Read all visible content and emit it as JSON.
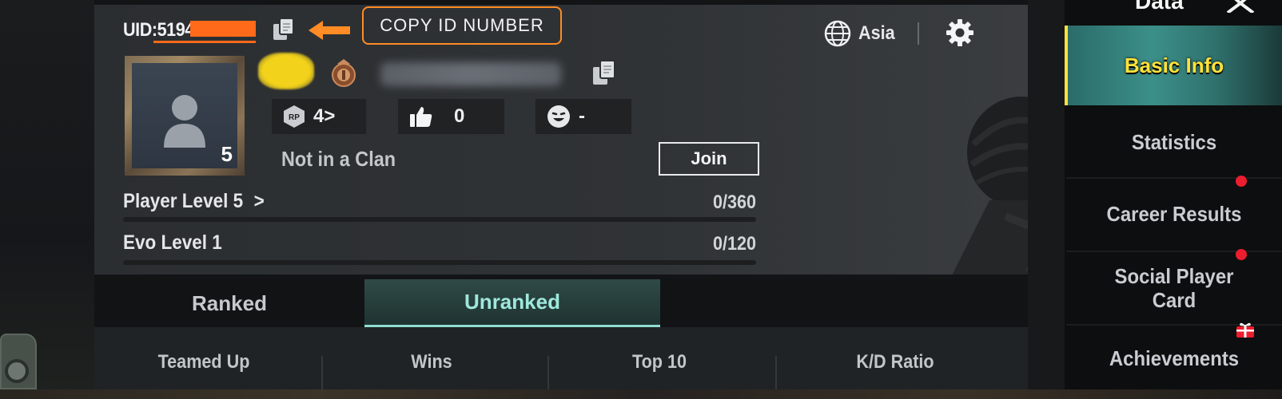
{
  "header": {
    "uid_label": "UID:5194",
    "callout_text": "COPY ID NUMBER",
    "region": "Asia"
  },
  "profile": {
    "avatar_level": "5",
    "stats": {
      "rp_value": "4>",
      "likes": "0",
      "emote_value": "-"
    },
    "clan_status": "Not in a Clan",
    "join_label": "Join",
    "player_level_label": "Player Level",
    "player_level_num": "5",
    "player_level_arrow": ">",
    "player_level_progress": "0/360",
    "player_level_fraction": 0,
    "evo_level_label": "Evo Level 1",
    "evo_level_progress": "0/120",
    "evo_level_fraction": 0
  },
  "tabs": [
    {
      "label": "Ranked",
      "active": false
    },
    {
      "label": "Unranked",
      "active": true
    }
  ],
  "stats_columns": [
    "Teamed Up",
    "Wins",
    "Top 10",
    "K/D Ratio"
  ],
  "nav": {
    "title": "Data",
    "items": [
      {
        "label": "Basic Info",
        "active": true,
        "badge": "none"
      },
      {
        "label": "Statistics",
        "active": false,
        "badge": "red-dot"
      },
      {
        "label": "Career Results",
        "active": false,
        "badge": "red-dot"
      },
      {
        "label": "Social Player Card",
        "active": false,
        "badge": "gift"
      },
      {
        "label": "Achievements",
        "active": false,
        "badge": "none"
      }
    ]
  },
  "icons": {
    "copy": "copy-icon",
    "arrow": "arrow-left-icon",
    "globe": "globe-icon",
    "settings": "gear-icon",
    "rp": "rp-badge-icon",
    "like": "thumbs-up-icon",
    "emote": "smiley-icon",
    "close": "close-icon",
    "gift": "gift-icon"
  },
  "colors": {
    "accent_orange": "#ff8c24",
    "tab_active": "#9fe8dc",
    "nav_active_text": "#ffe23a",
    "badge_red": "#ec1d2e"
  }
}
